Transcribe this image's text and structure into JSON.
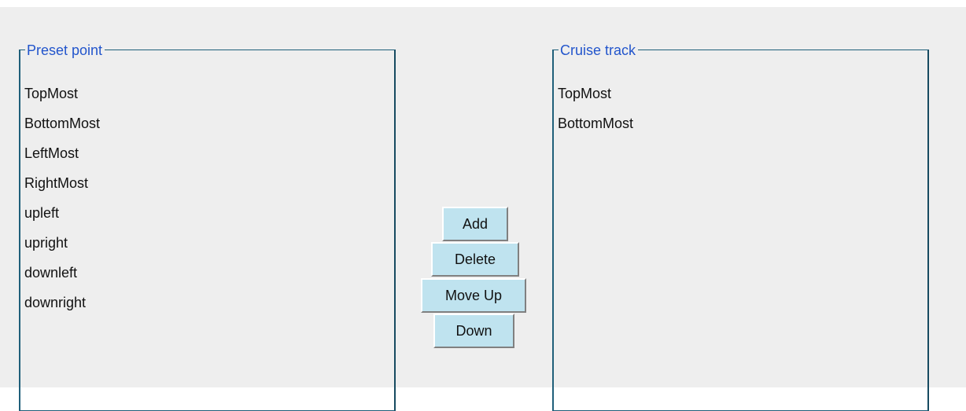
{
  "preset_panel": {
    "title": "Preset point",
    "items": [
      "TopMost",
      "BottomMost",
      "LeftMost",
      "RightMost",
      "upleft",
      "upright",
      "downleft",
      "downright"
    ]
  },
  "cruise_panel": {
    "title": "Cruise track",
    "items": [
      "TopMost",
      "BottomMost"
    ]
  },
  "buttons": {
    "add": "Add",
    "delete": "Delete",
    "move_up": "Move Up",
    "down": "Down"
  },
  "colors": {
    "legend_text": "#2255cc",
    "button_bg": "#bfe3ef",
    "panel_bg": "#eeeeee",
    "frame": "#1f5f7a"
  }
}
